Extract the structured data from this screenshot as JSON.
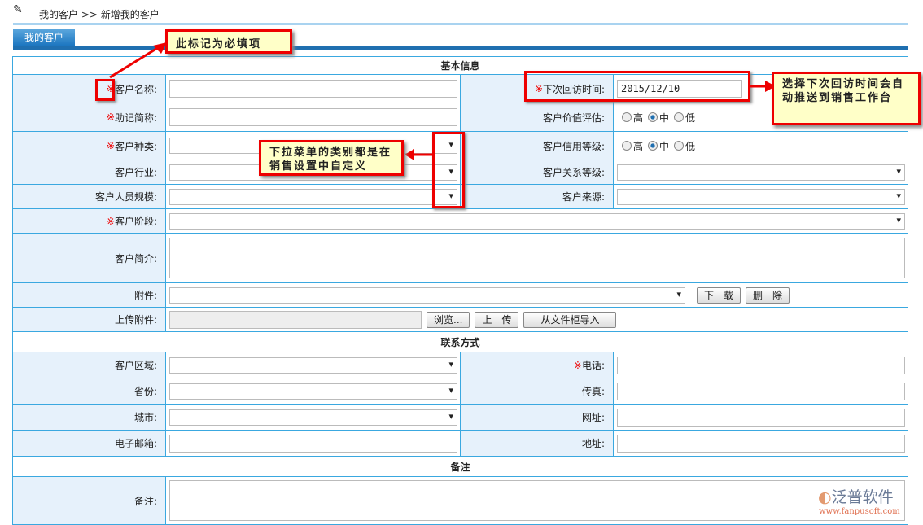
{
  "breadcrumb": {
    "root": "我的客户",
    "sep": ">>",
    "current": "新增我的客户"
  },
  "tab": "我的客户",
  "sections": {
    "basic": "基本信息",
    "contact": "联系方式",
    "remark": "备注"
  },
  "required_mark": "※",
  "fields": {
    "name": "客户名称:",
    "next_visit": "下次回访时间:",
    "next_visit_value": "2015/12/10",
    "abbr": "助记简称:",
    "value_eval": "客户价值评估:",
    "type": "客户种类:",
    "credit": "客户信用等级:",
    "industry": "客户行业:",
    "relation": "客户关系等级:",
    "staff": "客户人员规模:",
    "source": "客户来源:",
    "stage": "客户阶段:",
    "intro": "客户简介:",
    "attachment": "附件:",
    "upload": "上传附件:",
    "region": "客户区域:",
    "phone": "电话:",
    "province": "省份:",
    "fax": "传真:",
    "city": "城市:",
    "website": "网址:",
    "email": "电子邮箱:",
    "address": "地址:",
    "remark": "备注:"
  },
  "radio": {
    "high": "高",
    "mid": "中",
    "low": "低"
  },
  "buttons": {
    "download": "下　载",
    "delete": "删　除",
    "browse": "浏览...",
    "upload": "上　传",
    "import": "从文件柜导入"
  },
  "callouts": {
    "required": "此标记为必填项",
    "dropdown": "下拉菜单的类别都是在销售设置中自定义",
    "visit": "选择下次回访时间会自动推送到销售工作台"
  },
  "watermark": {
    "brand": "泛普软件",
    "url": "www.fanpusoft.com"
  }
}
